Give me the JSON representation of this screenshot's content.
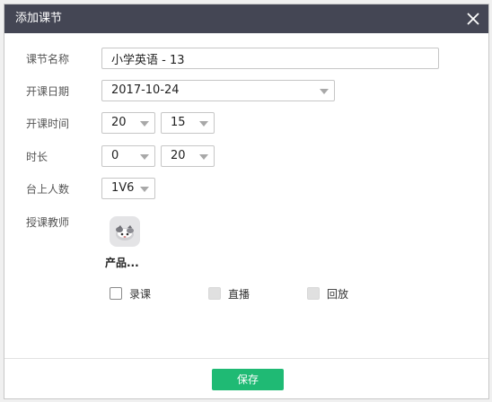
{
  "dialog": {
    "title": "添加课节",
    "close_icon": "close-icon"
  },
  "form": {
    "lesson_name": {
      "label": "课节名称",
      "value": "小学英语 - 13"
    },
    "start_date": {
      "label": "开课日期",
      "value": "2017-10-24"
    },
    "start_time": {
      "label": "开课时间",
      "hour": "20",
      "minute": "15"
    },
    "duration": {
      "label": "时长",
      "hours": "0",
      "minutes": "20"
    },
    "stage_count": {
      "label": "台上人数",
      "value": "1V6"
    },
    "teacher": {
      "label": "授课教师",
      "name": "产品..."
    }
  },
  "options": {
    "record": {
      "label": "录课",
      "enabled": true,
      "checked": false
    },
    "live": {
      "label": "直播",
      "enabled": false,
      "checked": false
    },
    "playback": {
      "label": "回放",
      "enabled": false,
      "checked": false
    }
  },
  "footer": {
    "save_label": "保存"
  },
  "colors": {
    "titlebar": "#444654",
    "save_button": "#1fba74"
  }
}
